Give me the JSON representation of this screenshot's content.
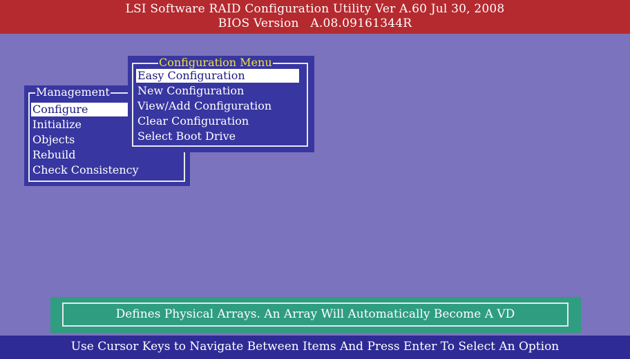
{
  "header": {
    "line1": "LSI Software RAID Configuration Utility Ver A.60 Jul 30, 2008",
    "line2": "BIOS Version   A.08.09161344R"
  },
  "management_menu": {
    "title": "Management",
    "items": [
      {
        "label": "Configure",
        "selected": true
      },
      {
        "label": "Initialize",
        "selected": false
      },
      {
        "label": "Objects",
        "selected": false
      },
      {
        "label": "Rebuild",
        "selected": false
      },
      {
        "label": "Check Consistency",
        "selected": false
      }
    ]
  },
  "configuration_menu": {
    "title": "Configuration Menu",
    "items": [
      {
        "label": "Easy Configuration",
        "selected": true
      },
      {
        "label": "New Configuration",
        "selected": false
      },
      {
        "label": "View/Add Configuration",
        "selected": false
      },
      {
        "label": "Clear Configuration",
        "selected": false
      },
      {
        "label": "Select Boot Drive",
        "selected": false
      }
    ]
  },
  "status": {
    "description": "Defines Physical Arrays. An Array Will Automatically Become A VD"
  },
  "footer": {
    "hint": "Use Cursor Keys to Navigate Between Items And Press Enter To Select An Option"
  },
  "colors": {
    "background": "#7b73bd",
    "header": "#b52a2f",
    "menu_panel": "#3836a0",
    "menu_title_config": "#f0e040",
    "status_box": "#2f9d7f",
    "footer": "#2e2b95"
  }
}
